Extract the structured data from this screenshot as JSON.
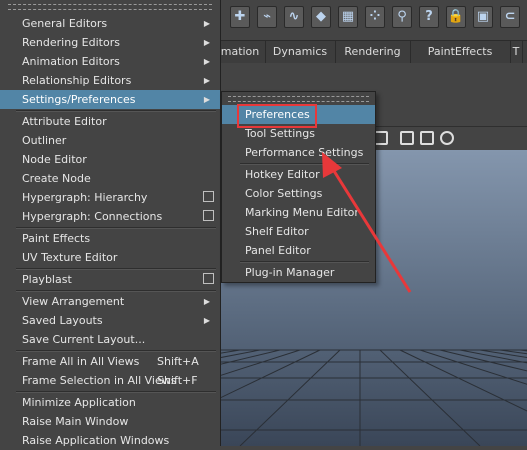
{
  "toolbar": {
    "icons": [
      "move-icon",
      "curve-icon",
      "snap-curve-icon",
      "snap-plane-icon",
      "snap-grid-icon",
      "snap-points-icon",
      "snap-live-icon",
      "help-icon",
      "lock-icon",
      "render-icon",
      "magnet-icon"
    ],
    "help_glyph": "?"
  },
  "tabs": [
    {
      "label": "mation"
    },
    {
      "label": "Dynamics"
    },
    {
      "label": "Rendering"
    },
    {
      "label": "PaintEffects"
    },
    {
      "label": "T"
    }
  ],
  "menu": {
    "groups": [
      [
        {
          "label": "General Editors",
          "arrow": true
        },
        {
          "label": "Rendering Editors",
          "arrow": true
        },
        {
          "label": "Animation Editors",
          "arrow": true
        },
        {
          "label": "Relationship Editors",
          "arrow": true
        },
        {
          "label": "Settings/Preferences",
          "arrow": true,
          "highlighted": true
        }
      ],
      [
        {
          "label": "Attribute Editor"
        },
        {
          "label": "Outliner"
        },
        {
          "label": "Node Editor"
        },
        {
          "label": "Create Node"
        },
        {
          "label": "Hypergraph: Hierarchy",
          "option": true
        },
        {
          "label": "Hypergraph: Connections",
          "option": true
        }
      ],
      [
        {
          "label": "Paint Effects"
        },
        {
          "label": "UV Texture Editor"
        }
      ],
      [
        {
          "label": "Playblast",
          "option": true
        }
      ],
      [
        {
          "label": "View Arrangement",
          "arrow": true
        },
        {
          "label": "Saved Layouts",
          "arrow": true
        },
        {
          "label": "Save Current Layout..."
        }
      ],
      [
        {
          "label": "Frame All in All Views",
          "shortcut": "Shift+A"
        },
        {
          "label": "Frame Selection in All Views",
          "shortcut": "Shift+F"
        }
      ],
      [
        {
          "label": "Minimize Application"
        },
        {
          "label": "Raise Main Window"
        },
        {
          "label": "Raise Application Windows"
        }
      ]
    ]
  },
  "submenu": {
    "groups": [
      [
        {
          "label": "Preferences",
          "selected": true
        },
        {
          "label": "Tool Settings"
        },
        {
          "label": "Performance Settings"
        }
      ],
      [
        {
          "label": "Hotkey Editor"
        },
        {
          "label": "Color Settings"
        },
        {
          "label": "Marking Menu Editor"
        },
        {
          "label": "Shelf Editor"
        },
        {
          "label": "Panel Editor"
        }
      ],
      [
        {
          "label": "Plug-in Manager"
        }
      ]
    ]
  },
  "annotation": {
    "color": "#e8383a"
  },
  "colors": {
    "menu_bg": "#444444",
    "highlight": "#5285a6"
  }
}
